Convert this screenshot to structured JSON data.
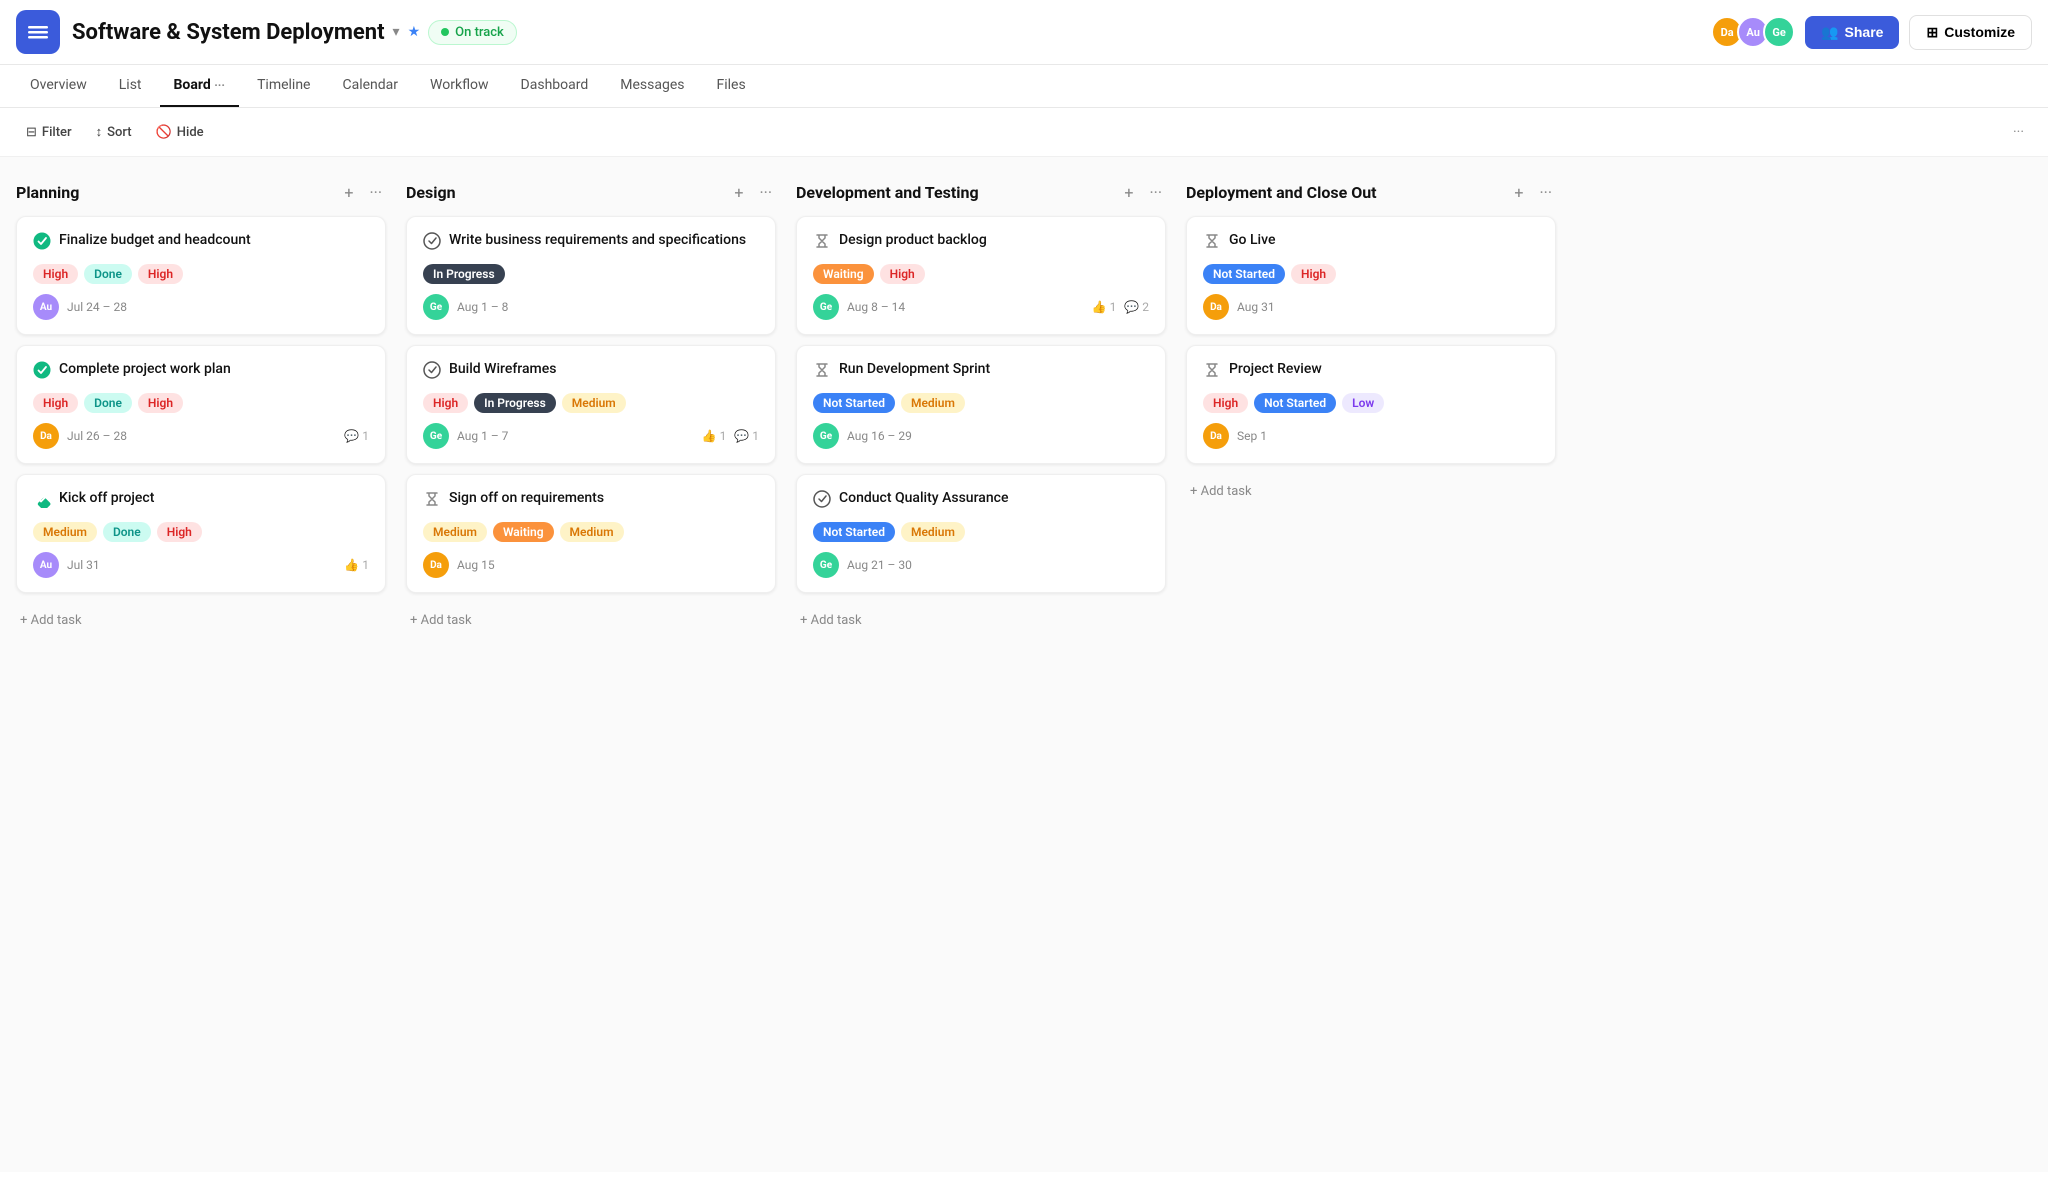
{
  "header": {
    "menu_label": "Menu",
    "title": "Software & System Deployment",
    "status": "On track",
    "share_label": "Share",
    "customize_label": "Customize"
  },
  "nav": {
    "tabs": [
      {
        "id": "overview",
        "label": "Overview"
      },
      {
        "id": "list",
        "label": "List"
      },
      {
        "id": "board",
        "label": "Board",
        "active": true
      },
      {
        "id": "timeline",
        "label": "Timeline"
      },
      {
        "id": "calendar",
        "label": "Calendar"
      },
      {
        "id": "workflow",
        "label": "Workflow"
      },
      {
        "id": "dashboard",
        "label": "Dashboard"
      },
      {
        "id": "messages",
        "label": "Messages"
      },
      {
        "id": "files",
        "label": "Files"
      }
    ]
  },
  "toolbar": {
    "filter_label": "Filter",
    "sort_label": "Sort",
    "hide_label": "Hide"
  },
  "columns": [
    {
      "id": "planning",
      "title": "Planning",
      "cards": [
        {
          "id": "p1",
          "icon": "✅",
          "title": "Finalize budget and headcount",
          "tags": [
            {
              "label": "High",
              "type": "high"
            },
            {
              "label": "Done",
              "type": "done"
            },
            {
              "label": "High",
              "type": "high"
            }
          ],
          "avatar": "Au",
          "avatar_color": "#a78bfa",
          "date": "Jul 24 – 28",
          "meta": []
        },
        {
          "id": "p2",
          "icon": "✅",
          "title": "Complete project work plan",
          "tags": [
            {
              "label": "High",
              "type": "high"
            },
            {
              "label": "Done",
              "type": "done"
            },
            {
              "label": "High",
              "type": "high"
            }
          ],
          "avatar": "Da",
          "avatar_color": "#f59e0b",
          "date": "Jul 26 – 28",
          "meta": [
            {
              "icon": "💬",
              "count": "1"
            }
          ]
        },
        {
          "id": "p3",
          "icon": "🔷",
          "title": "Kick off project",
          "tags": [
            {
              "label": "Medium",
              "type": "medium"
            },
            {
              "label": "Done",
              "type": "done"
            },
            {
              "label": "High",
              "type": "high"
            }
          ],
          "avatar": "Au",
          "avatar_color": "#a78bfa",
          "date": "Jul 31",
          "meta": [
            {
              "icon": "👍",
              "count": "1"
            }
          ]
        }
      ],
      "add_task_label": "+ Add task"
    },
    {
      "id": "design",
      "title": "Design",
      "cards": [
        {
          "id": "d1",
          "icon": "⊙",
          "title": "Write business requirements and specifications",
          "tags": [
            {
              "label": "In Progress",
              "type": "in-progress"
            }
          ],
          "avatar": "Ge",
          "avatar_color": "#34d399",
          "date": "Aug 1 – 8",
          "meta": []
        },
        {
          "id": "d2",
          "icon": "⊙",
          "title": "Build Wireframes",
          "tags": [
            {
              "label": "High",
              "type": "high"
            },
            {
              "label": "In Progress",
              "type": "in-progress"
            },
            {
              "label": "Medium",
              "type": "medium"
            }
          ],
          "avatar": "Ge",
          "avatar_color": "#34d399",
          "date": "Aug 1 – 7",
          "meta": [
            {
              "icon": "👍",
              "count": "1"
            },
            {
              "icon": "💬",
              "count": "1"
            }
          ]
        },
        {
          "id": "d3",
          "icon": "⏳",
          "title": "Sign off on requirements",
          "tags": [
            {
              "label": "Medium",
              "type": "medium"
            },
            {
              "label": "Waiting",
              "type": "waiting"
            },
            {
              "label": "Medium",
              "type": "medium"
            }
          ],
          "avatar": "Da",
          "avatar_color": "#f59e0b",
          "date": "Aug 15",
          "meta": []
        }
      ],
      "add_task_label": "+ Add task"
    },
    {
      "id": "dev-testing",
      "title": "Development and Testing",
      "cards": [
        {
          "id": "dt1",
          "icon": "⏳",
          "title": "Design product backlog",
          "tags": [
            {
              "label": "Waiting",
              "type": "waiting"
            },
            {
              "label": "High",
              "type": "high"
            }
          ],
          "avatar": "Ge",
          "avatar_color": "#34d399",
          "date": "Aug 8 – 14",
          "meta": [
            {
              "icon": "👍",
              "count": "1"
            },
            {
              "icon": "💬",
              "count": "2"
            }
          ]
        },
        {
          "id": "dt2",
          "icon": "⏳",
          "title": "Run Development Sprint",
          "tags": [
            {
              "label": "Not Started",
              "type": "not-started"
            },
            {
              "label": "Medium",
              "type": "medium"
            }
          ],
          "avatar": "Ge",
          "avatar_color": "#34d399",
          "date": "Aug 16 – 29",
          "meta": []
        },
        {
          "id": "dt3",
          "icon": "⊙",
          "title": "Conduct Quality Assurance",
          "tags": [
            {
              "label": "Not Started",
              "type": "not-started"
            },
            {
              "label": "Medium",
              "type": "medium"
            }
          ],
          "avatar": "Ge",
          "avatar_color": "#34d399",
          "date": "Aug 21 – 30",
          "meta": []
        }
      ],
      "add_task_label": "+ Add task"
    },
    {
      "id": "deployment",
      "title": "Deployment and Close Out",
      "cards": [
        {
          "id": "dep1",
          "icon": "⏳",
          "title": "Go Live",
          "tags": [
            {
              "label": "Not Started",
              "type": "not-started"
            },
            {
              "label": "High",
              "type": "high"
            }
          ],
          "avatar": "Da",
          "avatar_color": "#f59e0b",
          "date": "Aug 31",
          "meta": []
        },
        {
          "id": "dep2",
          "icon": "⏳",
          "title": "Project Review",
          "tags": [
            {
              "label": "High",
              "type": "high"
            },
            {
              "label": "Not Started",
              "type": "not-started"
            },
            {
              "label": "Low",
              "type": "low"
            }
          ],
          "avatar": "Da",
          "avatar_color": "#f59e0b",
          "date": "Sep 1",
          "meta": []
        }
      ],
      "add_task_label": "+ Add task"
    }
  ]
}
